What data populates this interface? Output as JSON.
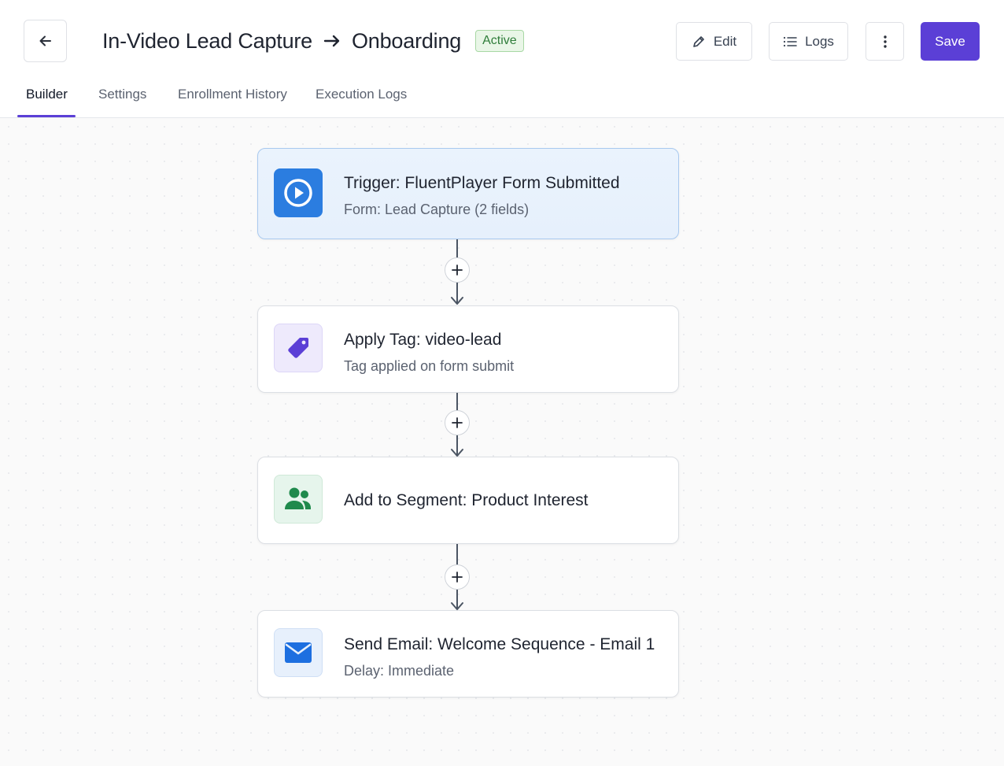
{
  "header": {
    "title_left": "In-Video Lead Capture",
    "title_right": "Onboarding",
    "status": "Active",
    "edit_label": "Edit",
    "logs_label": "Logs",
    "save_label": "Save"
  },
  "tabs": [
    {
      "label": "Builder",
      "active": true
    },
    {
      "label": "Settings",
      "active": false
    },
    {
      "label": "Enrollment History",
      "active": false
    },
    {
      "label": "Execution Logs",
      "active": false
    }
  ],
  "nodes": [
    {
      "title": "Trigger: FluentPlayer Form Submitted",
      "subtitle": "Form: Lead Capture (2 fields)",
      "icon": "play-icon",
      "color": "#2b7de0"
    },
    {
      "title": "Apply Tag: video-lead",
      "subtitle": "Tag applied on form submit",
      "icon": "tag-icon",
      "color": "#5b3fd6"
    },
    {
      "title": "Add to Segment: Product Interest",
      "subtitle": "",
      "icon": "users-icon",
      "color": "#1f8a4c"
    },
    {
      "title": "Send Email: Welcome Sequence - Email 1",
      "subtitle": "Delay: Immediate",
      "icon": "mail-icon",
      "color": "#1d6fe0"
    }
  ],
  "colors": {
    "accent": "#5b3fd6",
    "active_badge_bg": "#e9f6e7",
    "active_badge_text": "#2f7d3a"
  }
}
